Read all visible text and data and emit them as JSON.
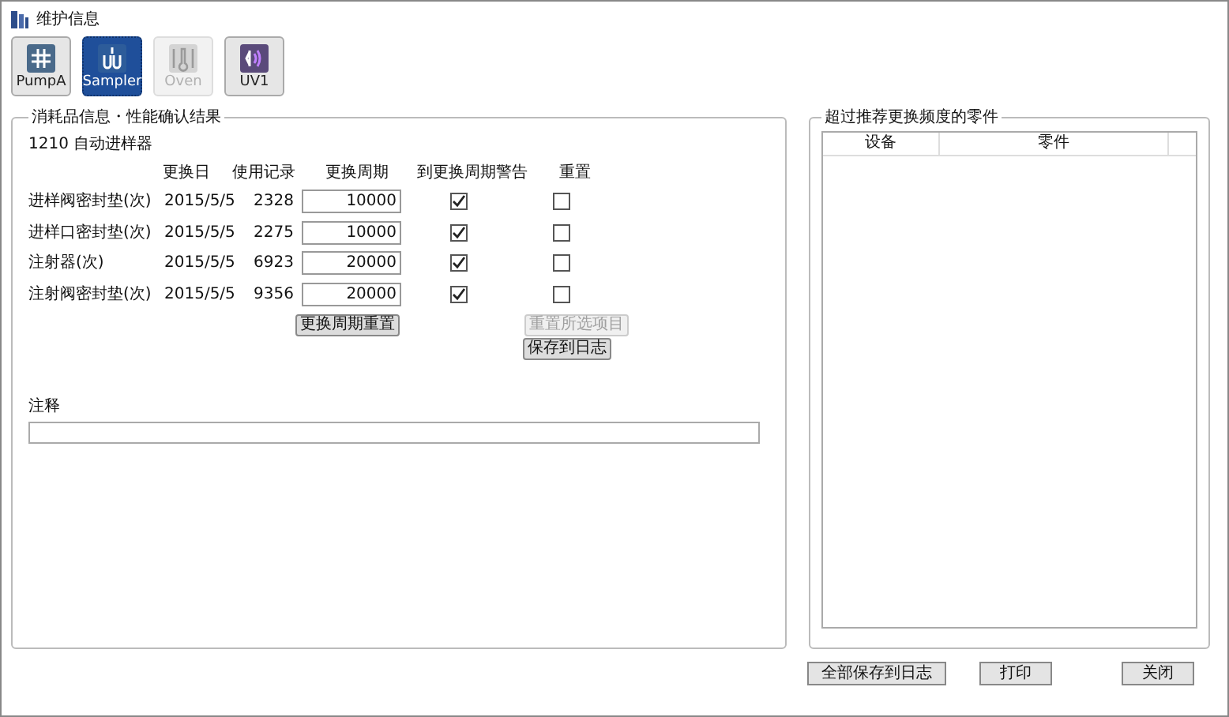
{
  "window": {
    "title": "维护信息"
  },
  "modules": [
    {
      "label": "PumpA",
      "kind": "pump",
      "selected": false,
      "disabled": false
    },
    {
      "label": "Sampler",
      "kind": "sampler",
      "selected": true,
      "disabled": false
    },
    {
      "label": "Oven",
      "kind": "oven",
      "selected": false,
      "disabled": true
    },
    {
      "label": "UV1",
      "kind": "uv",
      "selected": false,
      "disabled": false
    }
  ],
  "consumables": {
    "title": "消耗品信息・性能确认结果",
    "device": "1210 自动进样器",
    "columns": [
      "更换日",
      "使用记录",
      "更换周期",
      "到更换周期警告",
      "重置"
    ],
    "rows": [
      {
        "name": "进样阀密封垫(次)",
        "date": "2015/5/5",
        "usage": "2328",
        "cycle": "10000",
        "warn": true,
        "reset": false
      },
      {
        "name": "进样口密封垫(次)",
        "date": "2015/5/5",
        "usage": "2275",
        "cycle": "10000",
        "warn": true,
        "reset": false
      },
      {
        "name": "注射器(次)",
        "date": "2015/5/5",
        "usage": "6923",
        "cycle": "20000",
        "warn": true,
        "reset": false
      },
      {
        "name": "注射阀密封垫(次)",
        "date": "2015/5/5",
        "usage": "9356",
        "cycle": "20000",
        "warn": true,
        "reset": false
      }
    ],
    "reset_cycle_button": {
      "label": "更换周期重置",
      "disabled": false
    },
    "reset_selected_button": {
      "label": "重置所选项目",
      "disabled": true
    },
    "save_log_button": {
      "label": "保存到日志",
      "disabled": false
    },
    "note": {
      "label": "注释"
    }
  },
  "overdue": {
    "title": "超过推荐更换频度的零件",
    "columns": [
      "设备",
      "零件"
    ]
  },
  "buttons": [
    {
      "label": "全部保存到日志"
    },
    {
      "label": "打印"
    },
    {
      "label": "关闭"
    }
  ]
}
